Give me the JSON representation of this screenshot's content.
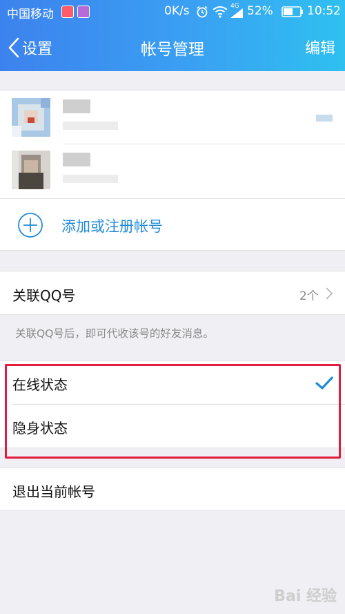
{
  "status_bar": {
    "carrier": "中国移动",
    "speed": "0K/s",
    "network": "4G",
    "battery": "52%",
    "time": "10:52"
  },
  "nav": {
    "back_label": "设置",
    "title": "帐号管理",
    "edit_label": "编辑"
  },
  "accounts": {
    "add_label": "添加或注册帐号"
  },
  "linked_qq": {
    "label": "关联QQ号",
    "count": "2个",
    "hint": "关联QQ号后，即可代收该号的好友消息。"
  },
  "status_options": [
    {
      "label": "在线状态",
      "selected": true
    },
    {
      "label": "隐身状态",
      "selected": false
    }
  ],
  "logout_label": "退出当前帐号",
  "watermark": {
    "text": "Bai 经验"
  },
  "colors": {
    "accent": "#1f8ad8",
    "header_start": "#3c82ee",
    "header_end": "#2fc0f0",
    "highlight": "#e31b3c",
    "background": "#efeff4"
  }
}
